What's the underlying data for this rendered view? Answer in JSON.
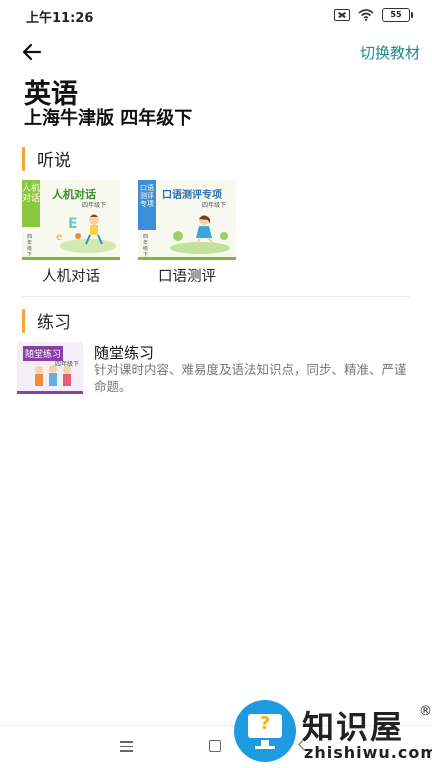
{
  "status_bar": {
    "time": "上午11:26",
    "battery": "55"
  },
  "header": {
    "switch_label": "切换教材"
  },
  "book": {
    "title": "英语",
    "edition": "上海牛津版 四年级下"
  },
  "listen_section": {
    "title": "听说",
    "cards": [
      {
        "label": "人机对话",
        "thumb_title": "人机对话",
        "thumb_side": "人机对话",
        "thumb_grade": "四年级下",
        "thumb_vertical": "四年级下"
      },
      {
        "label": "口语测评",
        "thumb_title": "口语测评专项",
        "thumb_side": "口语测评专项",
        "thumb_grade": "四年级下",
        "thumb_vertical": "四年级下"
      }
    ]
  },
  "practice_section": {
    "title": "练习",
    "items": [
      {
        "name": "随堂练习",
        "description": "针对课时内容、难易度及语法知识点，同步、精准、严谨命题。",
        "thumb_title": "随堂练习",
        "thumb_grade": "四年级下"
      }
    ]
  },
  "watermark": {
    "text": "知识屋",
    "reg": "®",
    "url": "zhishiwu.com"
  },
  "colors": {
    "accent": "#1f8a8a",
    "section_bar": "#f2a634",
    "green": "#8cc63e",
    "blue": "#3a8fd6",
    "purple": "#8a3fa8"
  }
}
